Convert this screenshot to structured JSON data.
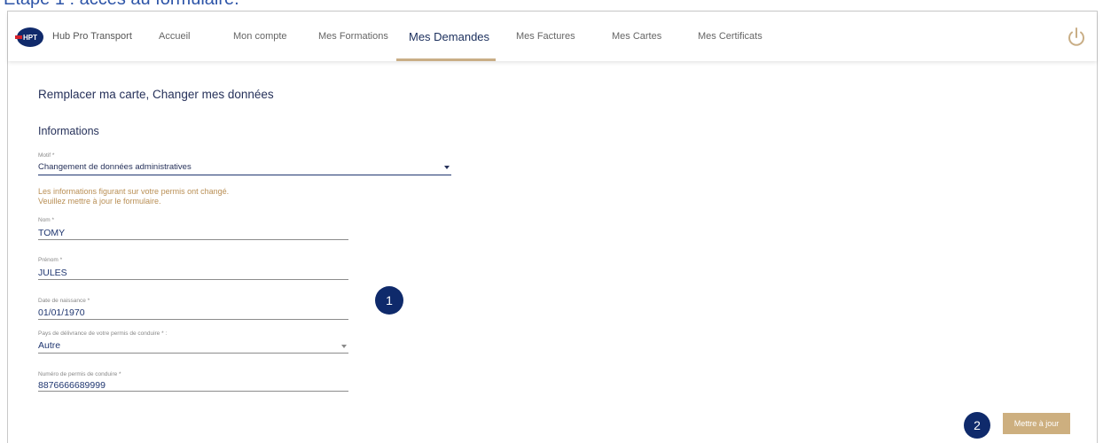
{
  "caption": "Etape 1 : accès au formulaire.",
  "header": {
    "logo_text": "HPT",
    "brand": "Hub Pro Transport",
    "nav": [
      {
        "label": "Accueil",
        "active": false
      },
      {
        "label": "Mon compte",
        "active": false
      },
      {
        "label": "Mes Formations",
        "active": false
      },
      {
        "label": "Mes Demandes",
        "active": true
      },
      {
        "label": "Mes Factures",
        "active": false
      },
      {
        "label": "Mes Cartes",
        "active": false
      },
      {
        "label": "Mes Certificats",
        "active": false
      }
    ],
    "power_icon": "power-icon"
  },
  "page": {
    "title": "Remplacer ma carte, Changer mes données",
    "section": "Informations"
  },
  "form": {
    "motif": {
      "label": "Motif *",
      "value": "Changement de données administratives"
    },
    "warning_line1": "Les informations figurant sur votre permis ont changé.",
    "warning_line2": "Veuillez mettre à jour le formulaire.",
    "nom": {
      "label": "Nom *",
      "value": "TOMY"
    },
    "prenom": {
      "label": "Prénom *",
      "value": "JULES"
    },
    "naissance": {
      "label": "Date de naissance *",
      "value": "01/01/1970"
    },
    "pays": {
      "label": "Pays de délivrance de votre permis de conduire * :",
      "value": "Autre"
    },
    "permis": {
      "label": "Numéro de permis de conduire *",
      "value": "8876666689999"
    },
    "submit_label": "Mettre à jour"
  },
  "badges": {
    "one": "1",
    "two": "2"
  },
  "colors": {
    "accent": "#c9ae86",
    "navy": "#0f2a6b",
    "warning": "#b98f55",
    "button": "#cdaf7f"
  }
}
